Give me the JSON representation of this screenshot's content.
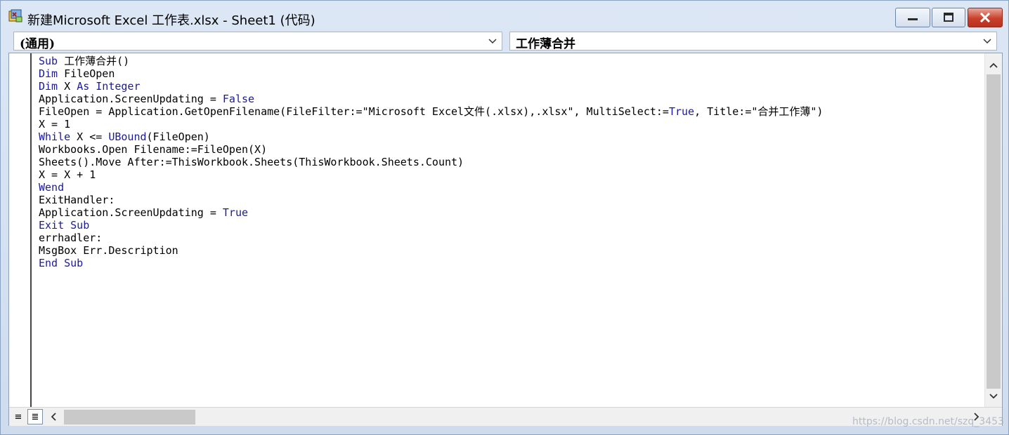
{
  "window": {
    "title": "新建Microsoft Excel 工作表.xlsx - Sheet1 (代码)"
  },
  "dropdowns": {
    "object": "(通用)",
    "procedure": "工作薄合并"
  },
  "code_lines": [
    [
      {
        "t": "Sub",
        "k": true
      },
      {
        "t": " 工作薄合并()",
        "k": false
      }
    ],
    [
      {
        "t": "Dim",
        "k": true
      },
      {
        "t": " FileOpen",
        "k": false
      }
    ],
    [
      {
        "t": "Dim",
        "k": true
      },
      {
        "t": " X ",
        "k": false
      },
      {
        "t": "As",
        "k": true
      },
      {
        "t": " ",
        "k": false
      },
      {
        "t": "Integer",
        "k": true
      }
    ],
    [
      {
        "t": "Application.ScreenUpdating = ",
        "k": false
      },
      {
        "t": "False",
        "k": true
      }
    ],
    [
      {
        "t": "FileOpen = Application.GetOpenFilename(FileFilter:=\"Microsoft Excel文件(.xlsx),.xlsx\", MultiSelect:=",
        "k": false
      },
      {
        "t": "True",
        "k": true
      },
      {
        "t": ", Title:=\"合并工作薄\")",
        "k": false
      }
    ],
    [
      {
        "t": "X = 1",
        "k": false
      }
    ],
    [
      {
        "t": "While",
        "k": true
      },
      {
        "t": " X <= ",
        "k": false
      },
      {
        "t": "UBound",
        "k": true
      },
      {
        "t": "(FileOpen)",
        "k": false
      }
    ],
    [
      {
        "t": "Workbooks.Open Filename:=FileOpen(X)",
        "k": false
      }
    ],
    [
      {
        "t": "Sheets().Move After:=ThisWorkbook.Sheets(ThisWorkbook.Sheets.Count)",
        "k": false
      }
    ],
    [
      {
        "t": "X = X + 1",
        "k": false
      }
    ],
    [
      {
        "t": "Wend",
        "k": true
      }
    ],
    [
      {
        "t": "ExitHandler:",
        "k": false
      }
    ],
    [
      {
        "t": "Application.ScreenUpdating = ",
        "k": false
      },
      {
        "t": "True",
        "k": true
      }
    ],
    [
      {
        "t": "Exit",
        "k": true
      },
      {
        "t": " ",
        "k": false
      },
      {
        "t": "Sub",
        "k": true
      }
    ],
    [
      {
        "t": "errhadler:",
        "k": false
      }
    ],
    [
      {
        "t": "MsgBox Err.Description",
        "k": false
      }
    ],
    [
      {
        "t": "End",
        "k": true
      },
      {
        "t": " ",
        "k": false
      },
      {
        "t": "Sub",
        "k": true
      }
    ]
  ],
  "view_buttons": {
    "procedure_view": "≡",
    "full_module_view": "≣"
  },
  "watermark": "https://blog.csdn.net/szq_3453",
  "icons": {
    "app": "vba-project-icon",
    "minimize": "minimize-icon",
    "maximize": "maximize-icon",
    "close": "close-icon"
  },
  "colors": {
    "keyword": "#1a1a9a",
    "close_button": "#c9402b"
  }
}
